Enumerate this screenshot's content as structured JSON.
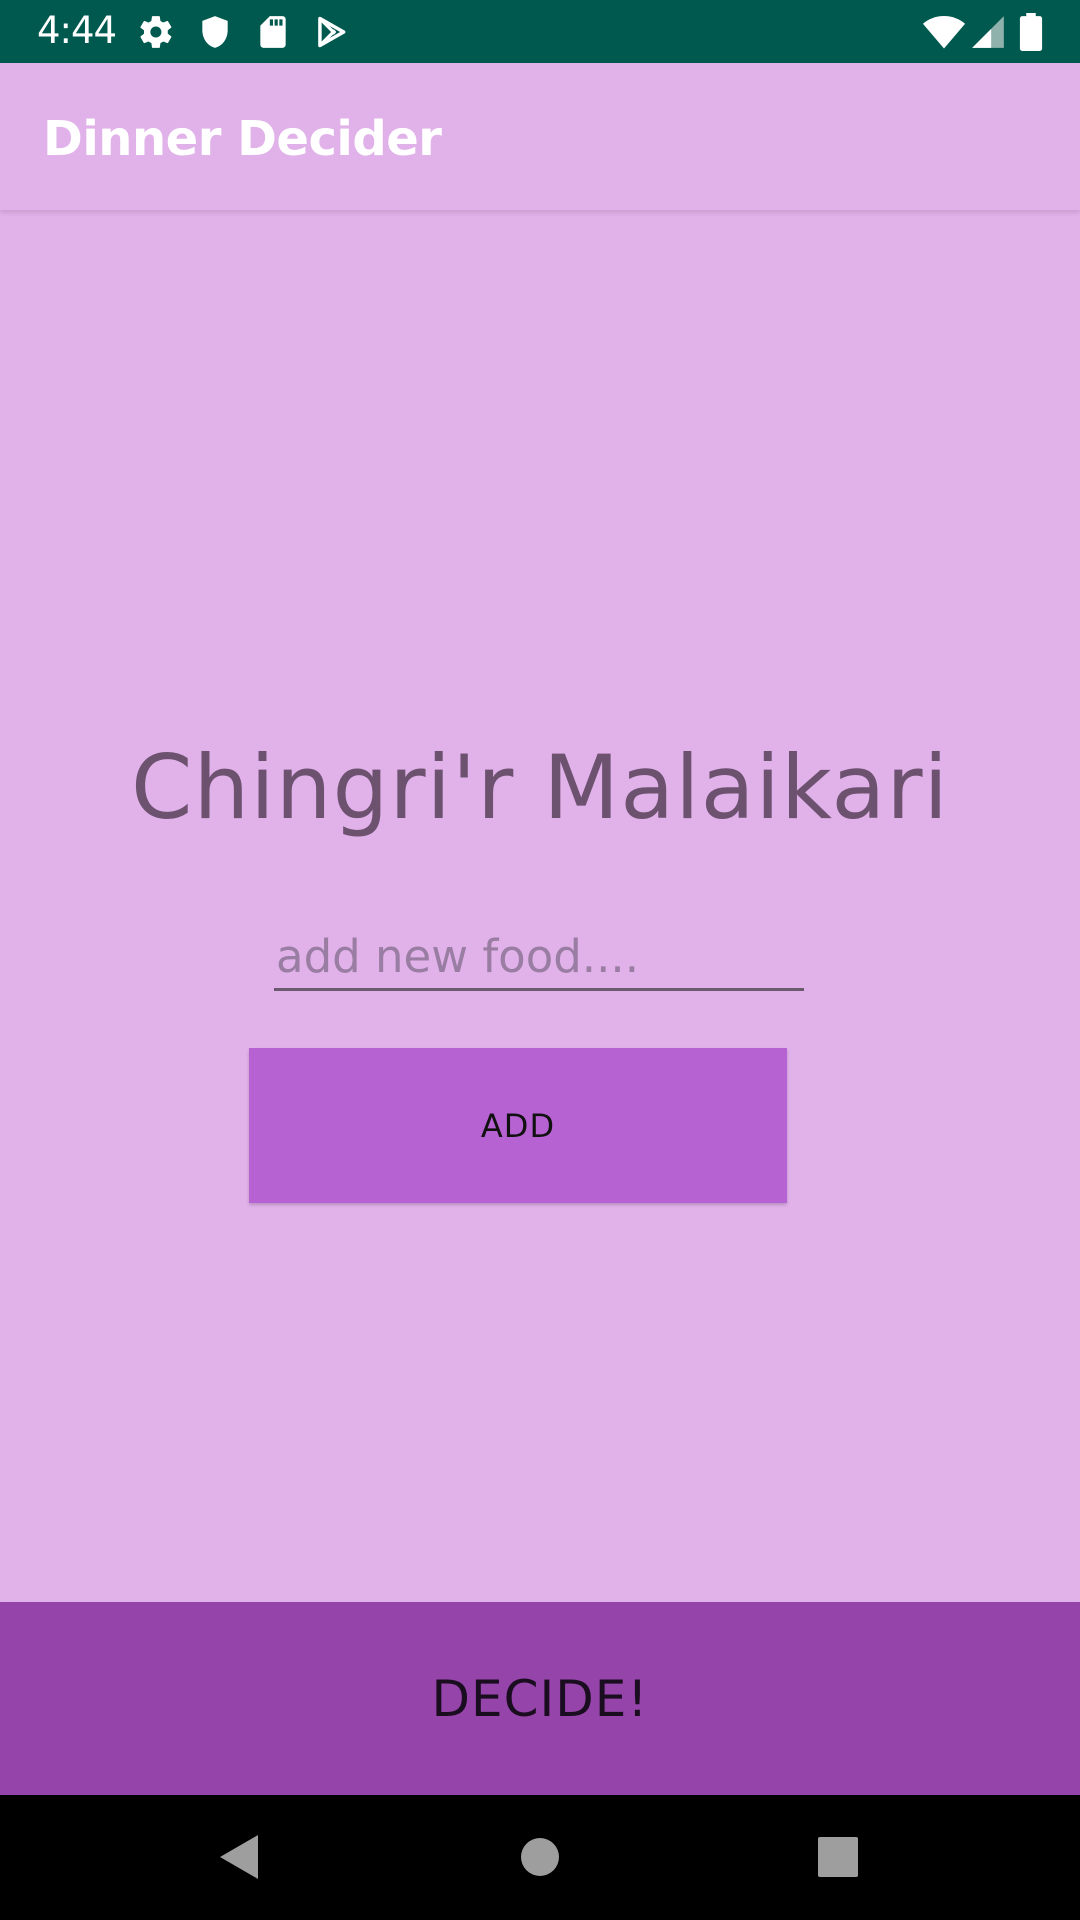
{
  "status_bar": {
    "time": "4:44",
    "icons": [
      "settings-icon",
      "shield-icon",
      "sd-card-icon",
      "play-store-icon",
      "wifi-icon",
      "cell-signal-icon",
      "battery-icon"
    ]
  },
  "app_bar": {
    "title": "Dinner Decider"
  },
  "main": {
    "selected_food": "Chingri'r Malaikari",
    "new_food_input": {
      "value": "",
      "placeholder": "add new food...."
    },
    "add_button_label": "ADD",
    "decide_button_label": "DECIDE!"
  },
  "nav_bar": {
    "buttons": [
      "back-icon",
      "home-icon",
      "recents-icon"
    ]
  },
  "colors": {
    "status_bar": "#00594f",
    "background": "#e1b1ea",
    "add_button": "#b762d2",
    "decide_button": "#9545aa",
    "food_text": "#6d5270"
  }
}
